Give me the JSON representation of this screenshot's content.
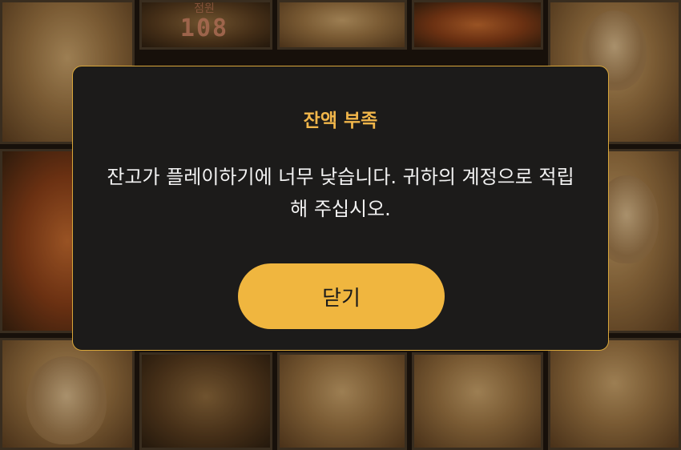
{
  "dialog": {
    "title": "잔액 부족",
    "message": "잔고가 플레이하기에 너무 낮습니다. 귀하의 계정으로 적립해 주십시오.",
    "close_label": "닫기"
  },
  "background": {
    "score_label": "점원",
    "score_value": "108"
  },
  "colors": {
    "accent": "#f0b63f",
    "title": "#f1b64a",
    "dialog_bg": "#1c1b1a",
    "dialog_border": "#d8a63a"
  }
}
